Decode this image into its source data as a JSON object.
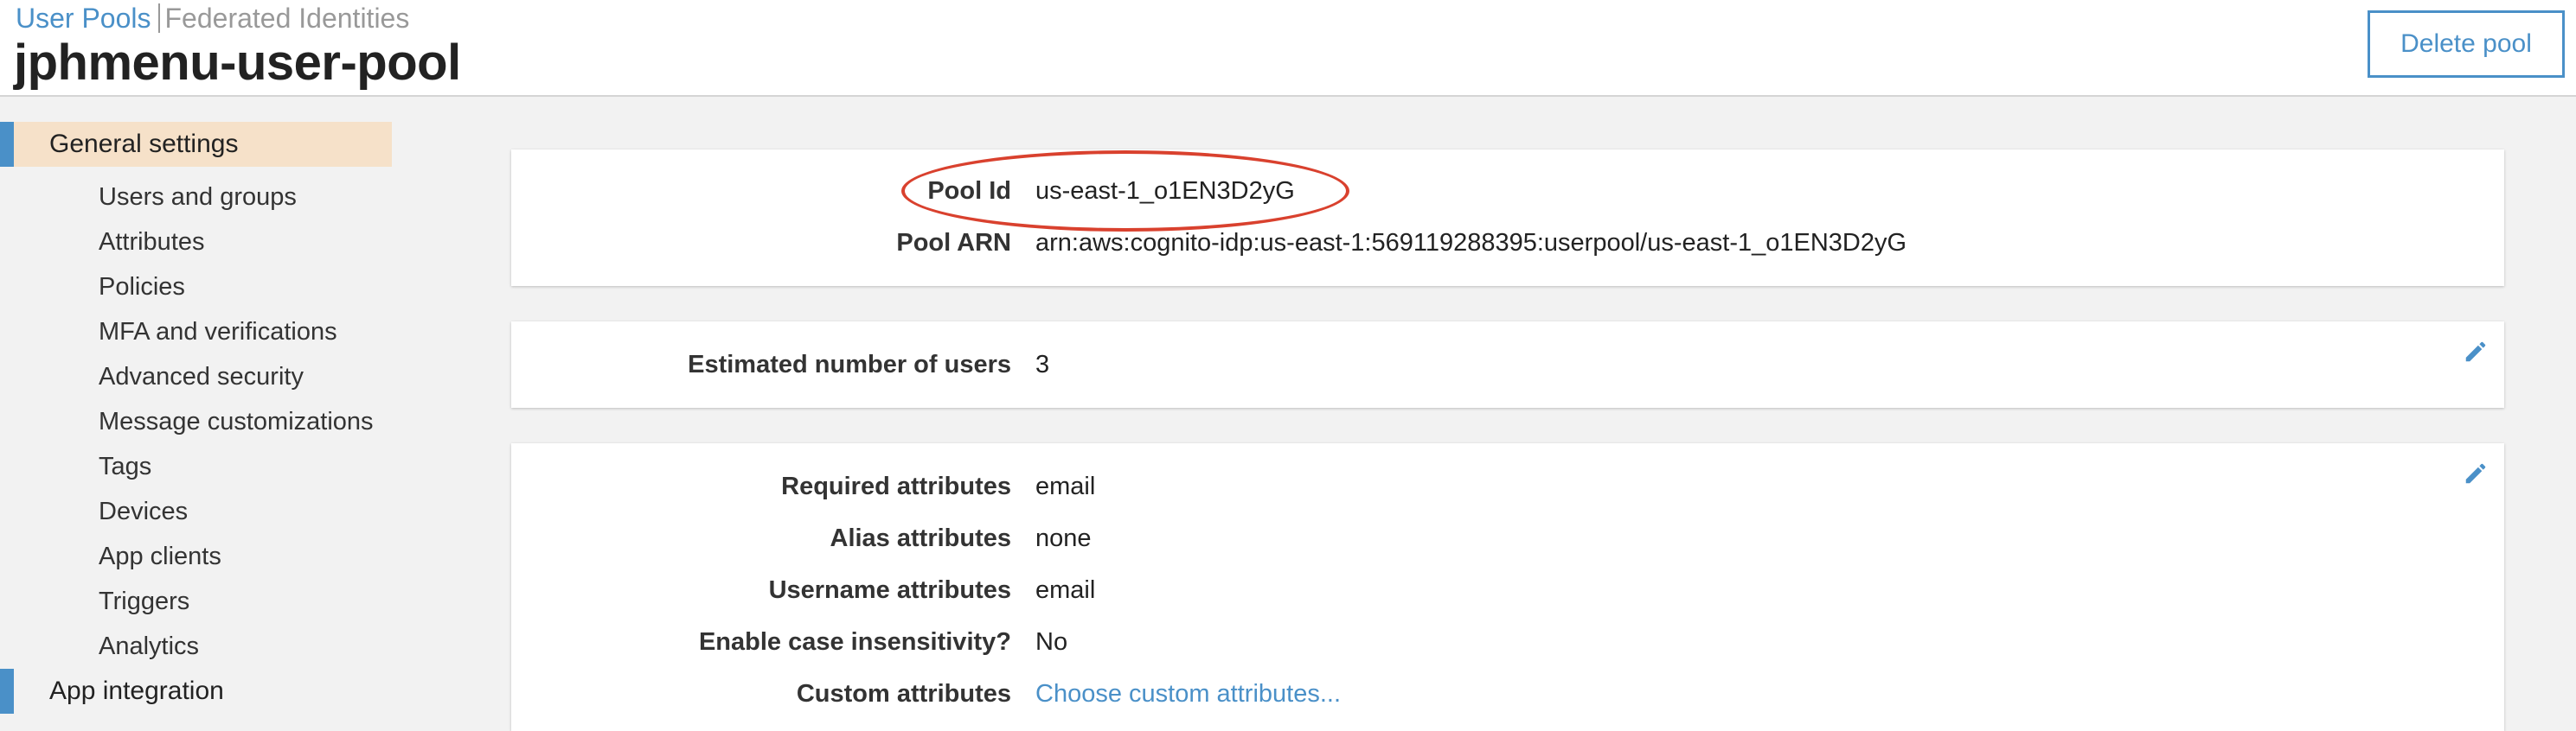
{
  "breadcrumb": {
    "user_pools": "User Pools",
    "federated": "Federated Identities"
  },
  "page_title": "jphmenu-user-pool",
  "actions": {
    "delete_label": "Delete pool"
  },
  "sidebar": {
    "general_settings": "General settings",
    "items": [
      {
        "label": "Users and groups"
      },
      {
        "label": "Attributes"
      },
      {
        "label": "Policies"
      },
      {
        "label": "MFA and verifications"
      },
      {
        "label": "Advanced security"
      },
      {
        "label": "Message customizations"
      },
      {
        "label": "Tags"
      },
      {
        "label": "Devices"
      },
      {
        "label": "App clients"
      },
      {
        "label": "Triggers"
      },
      {
        "label": "Analytics"
      }
    ],
    "app_integration": "App integration"
  },
  "pool_panel": {
    "pool_id_label": "Pool Id",
    "pool_id_value": "us-east-1_o1EN3D2yG",
    "pool_arn_label": "Pool ARN",
    "pool_arn_value": "arn:aws:cognito-idp:us-east-1:569119288395:userpool/us-east-1_o1EN3D2yG"
  },
  "users_panel": {
    "estimated_label": "Estimated number of users",
    "estimated_value": "3"
  },
  "attributes_panel": {
    "rows": [
      {
        "label": "Required attributes",
        "value": "email"
      },
      {
        "label": "Alias attributes",
        "value": "none"
      },
      {
        "label": "Username attributes",
        "value": "email"
      },
      {
        "label": "Enable case insensitivity?",
        "value": "No"
      },
      {
        "label": "Custom attributes",
        "value": "Choose custom attributes..."
      }
    ]
  },
  "colors": {
    "accent": "#4a90c8",
    "active_nav_bg": "#f6e1c9",
    "highlight_ellipse": "#d9412e",
    "page_bg": "#f2f2f2"
  },
  "icons": {
    "edit": "pencil-icon"
  }
}
